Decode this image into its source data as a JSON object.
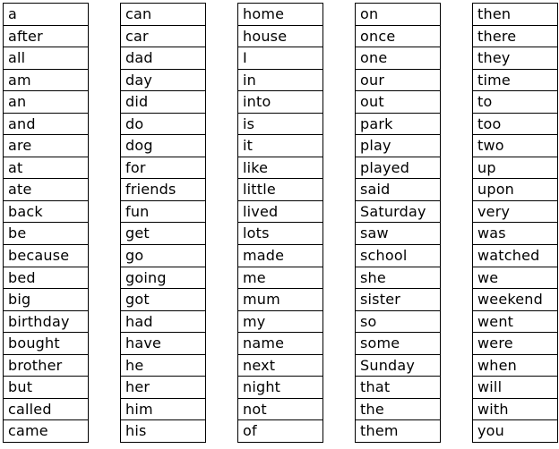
{
  "word_table": {
    "columns": [
      [
        "a",
        "after",
        "all",
        "am",
        "an",
        "and",
        "are",
        "at",
        "ate",
        "back",
        "be",
        "because",
        "bed",
        "big",
        "birthday",
        "bought",
        "brother",
        "but",
        "called",
        "came"
      ],
      [
        "can",
        "car",
        "dad",
        "day",
        "did",
        "do",
        "dog",
        "for",
        "friends",
        "fun",
        "get",
        "go",
        "going",
        "got",
        "had",
        "have",
        "he",
        "her",
        "him",
        "his"
      ],
      [
        "home",
        "house",
        "I",
        "in",
        "into",
        "is",
        "it",
        "like",
        "little",
        "lived",
        "lots",
        "made",
        "me",
        "mum",
        "my",
        "name",
        "next",
        "night",
        "not",
        "of"
      ],
      [
        "on",
        "once",
        "one",
        "our",
        "out",
        "park",
        "play",
        "played",
        "said",
        "Saturday",
        "saw",
        "school",
        "she",
        "sister",
        "so",
        "some",
        "Sunday",
        "that",
        "the",
        "them"
      ],
      [
        "then",
        "there",
        "they",
        "time",
        "to",
        "too",
        "two",
        "up",
        "upon",
        "very",
        "was",
        "watched",
        "we",
        "weekend",
        "went",
        "were",
        "when",
        "will",
        "with",
        "you"
      ]
    ]
  }
}
